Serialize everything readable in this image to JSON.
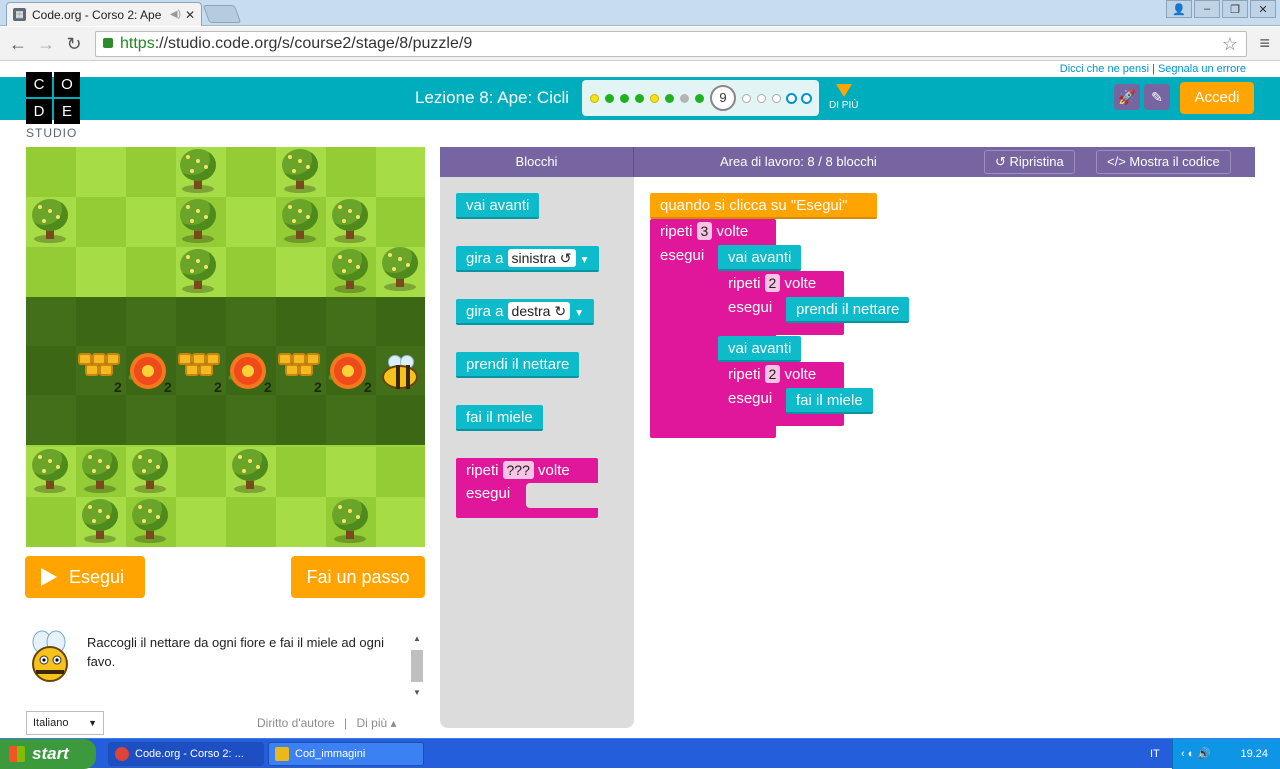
{
  "browser": {
    "tab_title": "Code.org - Corso 2: Ape",
    "url_https": "https",
    "url_rest": "://studio.code.org/s/course2/stage/8/puzzle/9"
  },
  "header": {
    "top_links": [
      "Dicci che ne pensi",
      "Segnala un errore"
    ],
    "logo_letters": [
      "C",
      "O",
      "D",
      "E"
    ],
    "studio": "STUDIO",
    "lesson_title": "Lezione 8: Ape: Cicli",
    "current_level": "9",
    "di_piu": "DI PIÙ",
    "accedi": "Accedi",
    "progress_dots": [
      "yellow",
      "green",
      "green",
      "green",
      "yellow",
      "green",
      "grey",
      "green",
      "current",
      "ring",
      "ring",
      "ring",
      "bigring",
      "bigring"
    ]
  },
  "game": {
    "path_counts": [
      "2",
      "2",
      "2",
      "2",
      "2",
      "2"
    ]
  },
  "controls": {
    "run": "Esegui",
    "step": "Fai un passo"
  },
  "instructions": {
    "text": "Raccogli il nettare da ogni fiore e fai il miele ad ogni favo."
  },
  "footer": {
    "language": "Italiano",
    "copyright": "Diritto d'autore",
    "more": "Di più ▴"
  },
  "blockly": {
    "toolbox_label": "Blocchi",
    "workspace_label": "Area di lavoro: 8 / 8 blocchi",
    "reset": "Ripristina",
    "show_code": "Mostra il codice",
    "toolbox": {
      "move_forward": "vai avanti",
      "turn_label": "gira a",
      "left": "sinistra ↺",
      "right": "destra ↻",
      "get_nectar": "prendi il nettare",
      "make_honey": "fai il miele",
      "repeat": "ripeti",
      "repeat_count": "???",
      "times": "volte",
      "do": "esegui"
    },
    "program": {
      "when_run": "quando si clicca su \"Esegui\"",
      "repeat": "ripeti",
      "times": "volte",
      "do": "esegui",
      "outer_count": "3",
      "inner_count_1": "2",
      "inner_count_2": "2",
      "move_forward": "vai avanti",
      "get_nectar": "prendi il nettare",
      "make_honey": "fai il miele"
    }
  },
  "taskbar": {
    "start": "start",
    "task1": "Code.org - Corso 2: ...",
    "task2": "Cod_immagini",
    "lang": "IT",
    "time": "19.24"
  }
}
